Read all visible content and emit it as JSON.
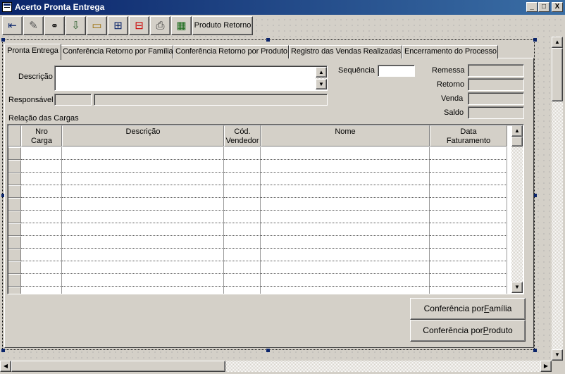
{
  "window": {
    "title": "Acerto Pronta Entrega",
    "controls": [
      "_",
      "□",
      "X"
    ]
  },
  "toolbar": {
    "buttons": [
      {
        "icon": "exit-door-icon"
      },
      {
        "icon": "eraser-icon"
      },
      {
        "icon": "binoculars-icon"
      },
      {
        "icon": "tray-import-icon"
      },
      {
        "icon": "folder-open-icon"
      },
      {
        "icon": "insert-record-icon"
      },
      {
        "icon": "delete-record-icon"
      },
      {
        "icon": "printer-icon"
      },
      {
        "icon": "spreadsheet-icon"
      }
    ],
    "produto_retorno_label": "Produto Retorno"
  },
  "tabs": [
    "Pronta Entrega",
    "Conferência Retorno por Família",
    "Conferência Retorno por Produto",
    "Registro das Vendas Realizadas",
    "Encerramento do Processo"
  ],
  "form": {
    "descricao_label": "Descrição",
    "descricao_value": "",
    "responsavel_label": "Responsável",
    "responsavel_code": "",
    "responsavel_name": "",
    "sequencia_label": "Sequência",
    "sequencia_value": "",
    "remessa_label": "Remessa",
    "remessa_value": "",
    "retorno_label": "Retorno",
    "retorno_value": "",
    "venda_label": "Venda",
    "venda_value": "",
    "saldo_label": "Saldo",
    "saldo_value": ""
  },
  "grid": {
    "caption": "Relação das Cargas",
    "columns": [
      {
        "line1": "Nro",
        "line2": "Carga"
      },
      {
        "line1": "Descrição",
        "line2": ""
      },
      {
        "line1": "Cód.",
        "line2": "Vendedor"
      },
      {
        "line1": "Nome",
        "line2": ""
      },
      {
        "line1": "Data",
        "line2": "Faturamento"
      }
    ],
    "rows": []
  },
  "buttons": {
    "conf_familia": {
      "before": "Conferência por ",
      "accel": "F",
      "after": "amília"
    },
    "conf_produto": {
      "before": "Conferência por ",
      "accel": "P",
      "after": "roduto"
    }
  },
  "colors": {
    "titlebar_start": "#0a246a",
    "titlebar_end": "#3a6ea5",
    "face": "#d4d0c8"
  }
}
